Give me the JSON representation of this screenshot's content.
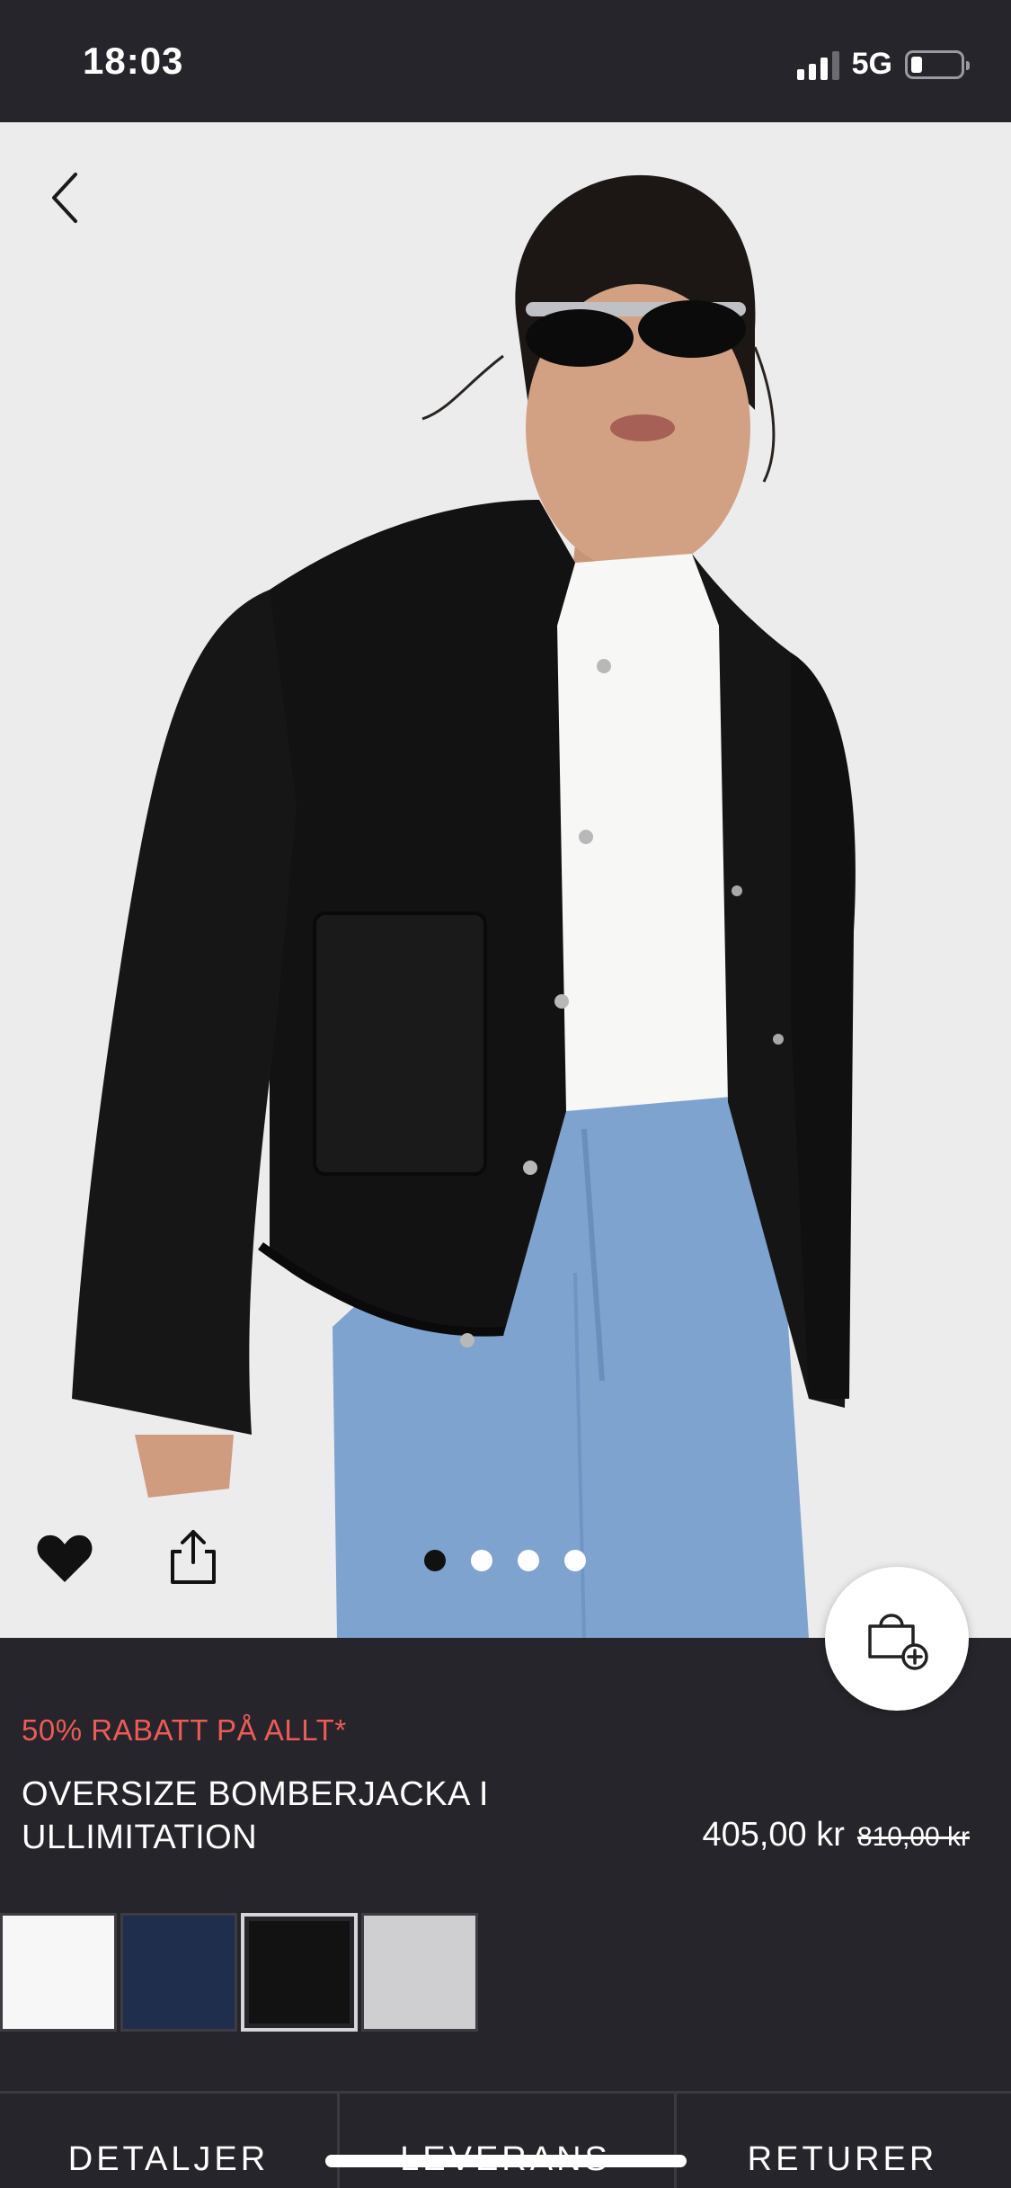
{
  "status_bar": {
    "time": "18:03",
    "network": "5G",
    "icons": [
      "signal-icon",
      "battery-icon"
    ]
  },
  "hero": {
    "back_icon": "chevron-left-icon",
    "favorite_icon": "heart-icon",
    "share_icon": "share-icon",
    "carousel": {
      "total": 4,
      "active": 1
    },
    "add_to_bag_icon": "bag-plus-icon"
  },
  "product": {
    "promo": "50% RABATT PÅ ALLT*",
    "title": "OVERSIZE BOMBERJACKA I ULLIMITATION",
    "price": "405,00 kr",
    "original_price": "810,00 kr"
  },
  "swatches": [
    {
      "color": "#f7f7f7",
      "selected": false
    },
    {
      "color": "#1f2e4d",
      "selected": false
    },
    {
      "color": "#121212",
      "selected": true
    },
    {
      "color": "#cfcfd1",
      "selected": false
    }
  ],
  "tabs": [
    {
      "label": "DETALJER"
    },
    {
      "label": "LEVERANS"
    },
    {
      "label": "RETURER"
    }
  ],
  "colors": {
    "background": "#25252b",
    "promo": "#ec5b56",
    "image_bg": "#ececed"
  }
}
